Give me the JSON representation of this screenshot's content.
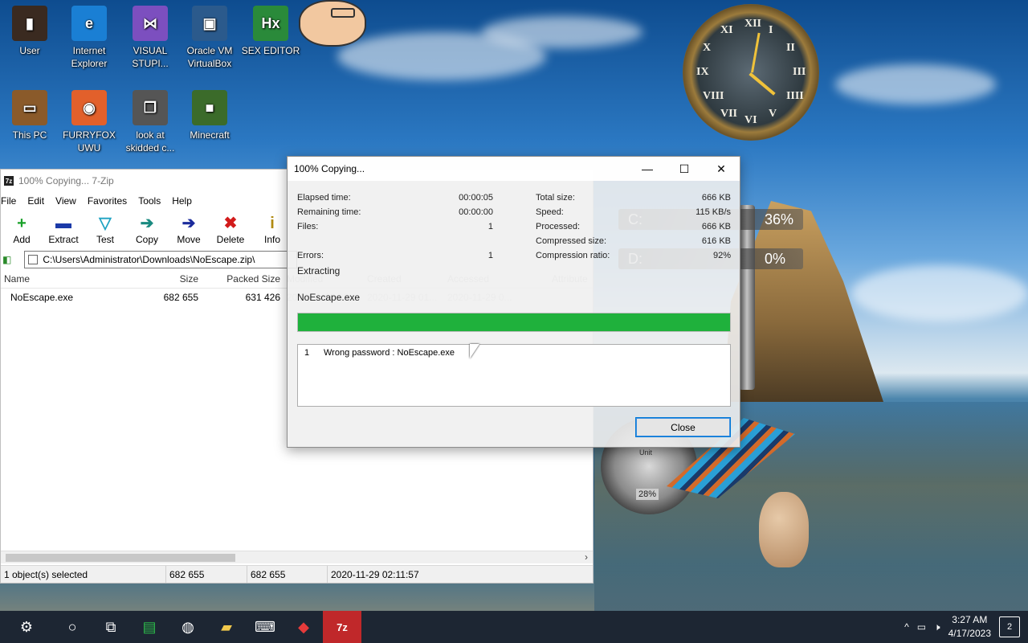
{
  "desktop": {
    "icons": [
      {
        "label": "User",
        "glyph": "▮",
        "color": "#3a2a20"
      },
      {
        "label": "Internet Explorer",
        "glyph": "e",
        "color": "#1a7fd4"
      },
      {
        "label": "VISUAL STUPI...",
        "glyph": "⋈",
        "color": "#7c4fbf"
      },
      {
        "label": "Oracle VM VirtualBox",
        "glyph": "▣",
        "color": "#2b5a8c"
      },
      {
        "label": "SEX EDITOR",
        "glyph": "Hx",
        "color": "#2a8a3a"
      },
      {
        "label": "This PC",
        "glyph": "▭",
        "color": "#8a5a2a"
      },
      {
        "label": "FURRYFOX UWU",
        "glyph": "◉",
        "color": "#e2602b"
      },
      {
        "label": "look at skidded c...",
        "glyph": "❐",
        "color": "#555"
      },
      {
        "label": "Minecraft",
        "glyph": "■",
        "color": "#3b6b2a"
      }
    ]
  },
  "widgets": {
    "clock_numerals": [
      "XII",
      "I",
      "II",
      "III",
      "IIII",
      "V",
      "VI",
      "VII",
      "VIII",
      "IX",
      "X",
      "XI"
    ],
    "gauge_c": {
      "label": "C:",
      "value": "36%"
    },
    "gauge_d": {
      "label": "D:",
      "value": "0%"
    },
    "small_gauge_value": "28%",
    "small_gauge_label": "Unit"
  },
  "zip_window": {
    "title": "100% Copying... 7-Zip",
    "menu": [
      "File",
      "Edit",
      "View",
      "Favorites",
      "Tools",
      "Help"
    ],
    "toolbar": [
      {
        "label": "Add",
        "glyph": "+",
        "color": "#1aa12a"
      },
      {
        "label": "Extract",
        "glyph": "▬",
        "color": "#1b3aa8"
      },
      {
        "label": "Test",
        "glyph": "▽",
        "color": "#1fa3c2"
      },
      {
        "label": "Copy",
        "glyph": "➔",
        "color": "#1a8a80"
      },
      {
        "label": "Move",
        "glyph": "➔",
        "color": "#1b2b9c"
      },
      {
        "label": "Delete",
        "glyph": "✖",
        "color": "#d21b1b"
      },
      {
        "label": "Info",
        "glyph": "i",
        "color": "#b08a10"
      }
    ],
    "address": "C:\\Users\\Administrator\\Downloads\\NoEscape.zip\\",
    "columns": [
      "Name",
      "Size",
      "Packed Size",
      "Modified",
      "Created",
      "Accessed",
      "Attribute"
    ],
    "rows": [
      {
        "name": "NoEscape.exe",
        "size": "682 655",
        "packed": "631 426",
        "modified": "2020-11-29 02:...",
        "created": "2020-11-29 01...",
        "accessed": "2020-11-29 0..."
      }
    ],
    "status": {
      "selected": "1 object(s) selected",
      "size": "682 655",
      "packed": "682 655",
      "modified": "2020-11-29 02:11:57"
    }
  },
  "copy_dialog": {
    "title": "100% Copying...",
    "controls": {
      "minimize": "—",
      "maximize": "☐",
      "close": "✕"
    },
    "left_stats": [
      {
        "label": "Elapsed time:",
        "value": "00:00:05"
      },
      {
        "label": "Remaining time:",
        "value": "00:00:00"
      },
      {
        "label": "Files:",
        "value": "1"
      },
      {
        "label": "Errors:",
        "value": "1"
      }
    ],
    "right_stats": [
      {
        "label": "Total size:",
        "value": "666 KB"
      },
      {
        "label": "Speed:",
        "value": "115 KB/s"
      },
      {
        "label": "Processed:",
        "value": "666 KB"
      },
      {
        "label": "Compressed size:",
        "value": "616 KB"
      },
      {
        "label": "Compression ratio:",
        "value": "92%"
      }
    ],
    "operation": "Extracting",
    "current_file": "NoEscape.exe",
    "progress": 1.0,
    "errors": [
      {
        "index": "1",
        "message": "Wrong password : NoEscape.exe"
      }
    ],
    "close_label": "Close"
  },
  "taskbar": {
    "items": [
      {
        "name": "start-orb",
        "glyph": "⚙",
        "active": false
      },
      {
        "name": "search",
        "glyph": "○",
        "active": false
      },
      {
        "name": "task-view",
        "glyph": "⧉",
        "active": false
      },
      {
        "name": "app-green",
        "glyph": "▤",
        "active": false
      },
      {
        "name": "chrome",
        "glyph": "◍",
        "active": false
      },
      {
        "name": "file-explorer",
        "glyph": "▰",
        "active": false
      },
      {
        "name": "keyboard-app",
        "glyph": "⌨",
        "active": false
      },
      {
        "name": "red-app",
        "glyph": "◆",
        "active": false
      },
      {
        "name": "7zip",
        "glyph": "7z",
        "active": true
      }
    ],
    "time": "3:27 AM",
    "date": "4/17/2023",
    "notification_count": "2"
  }
}
